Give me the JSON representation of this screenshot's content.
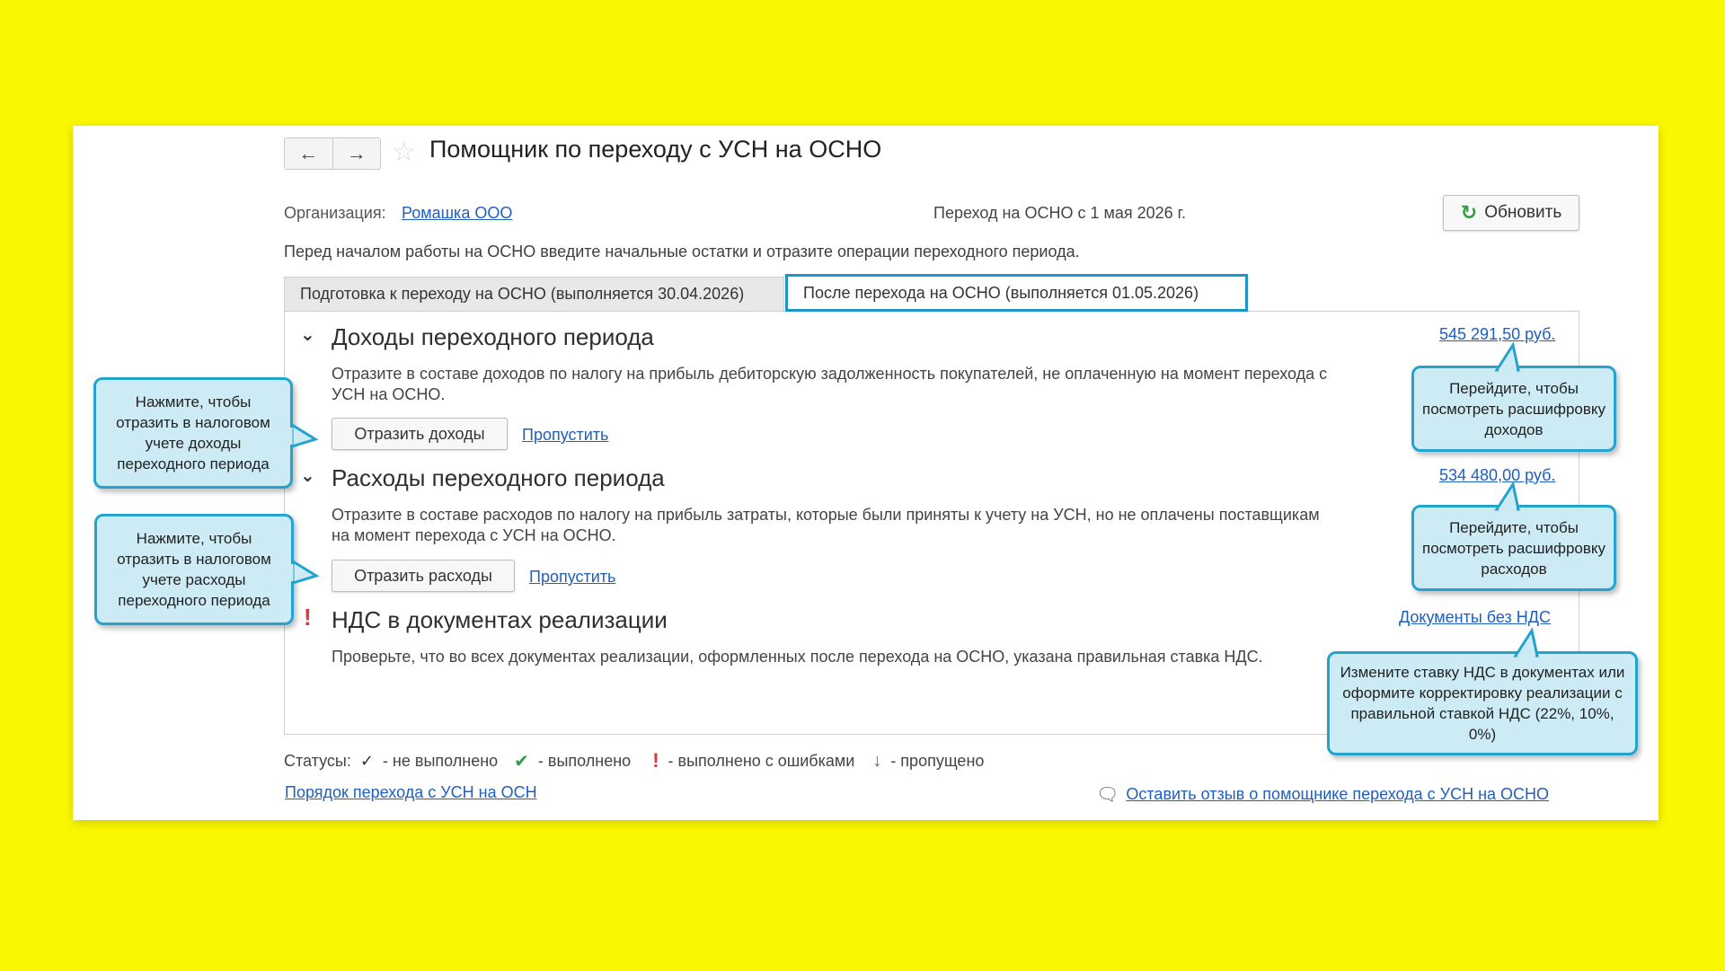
{
  "header": {
    "back_icon": "arrow-left-icon",
    "forward_icon": "arrow-right-icon",
    "favorite_icon": "star-icon",
    "title": "Помощник по переходу с УСН на ОСНО"
  },
  "organization": {
    "label": "Организация:",
    "value": "Ромашка ООО"
  },
  "transition_text": "Переход на ОСНО с 1 мая 2026 г.",
  "refresh": {
    "label": "Обновить",
    "icon": "refresh-icon"
  },
  "intro": "Перед началом работы на ОСНО введите начальные остатки и отразите операции переходного периода.",
  "tabs": [
    {
      "label": "Подготовка к переходу на ОСНО (выполняется 30.04.2026)"
    },
    {
      "label": "После перехода на ОСНО (выполняется 01.05.2026)"
    }
  ],
  "sections": {
    "income": {
      "title": "Доходы переходного периода",
      "amount": "545 291,50 руб.",
      "description": "Отразите в составе доходов по налогу на прибыль дебиторскую задолженность покупателей, не оплаченную на момент перехода с УСН на ОСНО.",
      "action_label": "Отразить доходы",
      "skip_label": "Пропустить"
    },
    "expenses": {
      "title": "Расходы переходного периода",
      "amount": "534 480,00 руб.",
      "description": "Отразите в составе расходов по налогу на прибыль затраты, которые были приняты к учету на УСН, но не оплачены поставщикам на момент перехода с УСН на ОСНО.",
      "action_label": "Отразить расходы",
      "skip_label": "Пропустить"
    },
    "vat": {
      "title": "НДС в документах реализации",
      "link": "Документы без НДС",
      "description": "Проверьте, что во всех документах реализации, оформленных после перехода на ОСНО, указана правильная ставка НДС."
    }
  },
  "callouts": {
    "income_action": "Нажмите, чтобы отразить в налоговом учете доходы переходного периода",
    "expenses_action": "Нажмите, чтобы отразить в налоговом учете расходы переходного периода",
    "income_amount": "Перейдите, чтобы посмотреть расшифровку доходов",
    "expenses_amount": "Перейдите, чтобы посмотреть расшифровку расходов",
    "vat_link": "Измените ставку НДС в документах или оформите корректировку реализации с правильной ставкой НДС (22%, 10%, 0%)"
  },
  "statuses": {
    "label": "Статусы:",
    "not_done": "- не выполнено",
    "done": "- выполнено",
    "with_errors": "- выполнено с ошибками",
    "skipped": "- пропущено"
  },
  "footer": {
    "procedure_link": "Порядок перехода с УСН на ОСН",
    "feedback_link": "Оставить отзыв о помощнике перехода с УСН на ОСНО"
  },
  "colors": {
    "background": "#fbf700",
    "link": "#1f5fbf",
    "callout_fill": "#cdebf5",
    "callout_border": "#24a3cf",
    "success": "#2ea043",
    "error": "#e0333a"
  }
}
